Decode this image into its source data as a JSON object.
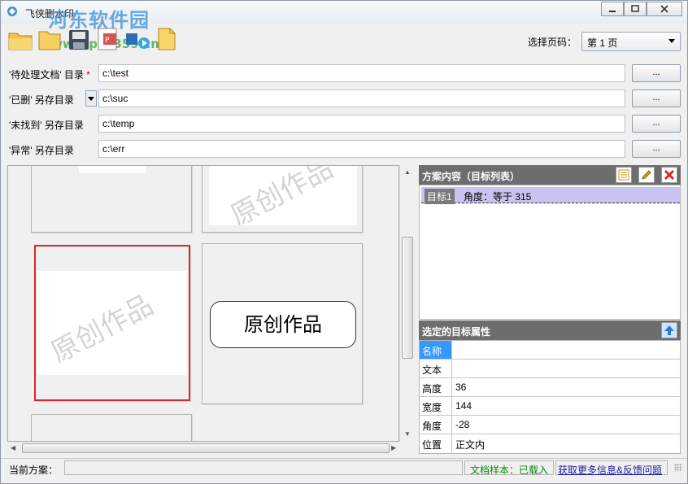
{
  "window": {
    "title": "飞侠删水印",
    "watermark_logo": "河东软件园",
    "watermark_url": "www.pc0359.cn"
  },
  "toolbar": {
    "icons": [
      "open-folder-icon",
      "save-icon",
      "export-icon",
      "run-icon",
      "file-icon"
    ],
    "page_label": "选择页码：",
    "page_value": "第 1 页"
  },
  "paths": [
    {
      "label": "'待处理文档' 目录",
      "required": "*",
      "value": "c:\\test",
      "button": "..."
    },
    {
      "label": "'已删'   另存目录",
      "value": "c:\\suc",
      "button": "..."
    },
    {
      "label": "'未找到' 另存目录",
      "value": "c:\\temp",
      "button": "..."
    },
    {
      "label": "'异常'   另存目录",
      "value": "c:\\err",
      "button": "..."
    }
  ],
  "preview": {
    "thumb_watermark": "原创作品",
    "seal_text": "原创作品"
  },
  "scheme": {
    "title": "方案内容（目标列表）",
    "targets": [
      {
        "tag": "目标1",
        "desc": "角度：等于 315"
      }
    ]
  },
  "props": {
    "title": "选定的目标属性",
    "rows": [
      {
        "key": "名称",
        "value": ""
      },
      {
        "key": "文本",
        "value": ""
      },
      {
        "key": "高度",
        "value": "36"
      },
      {
        "key": "宽度",
        "value": "144"
      },
      {
        "key": "角度",
        "value": "-28"
      },
      {
        "key": "位置",
        "value": "正文内"
      }
    ]
  },
  "status": {
    "label": "当前方案：",
    "loaded": "文档样本：已载入",
    "link": "获取更多信息&反馈问题"
  }
}
